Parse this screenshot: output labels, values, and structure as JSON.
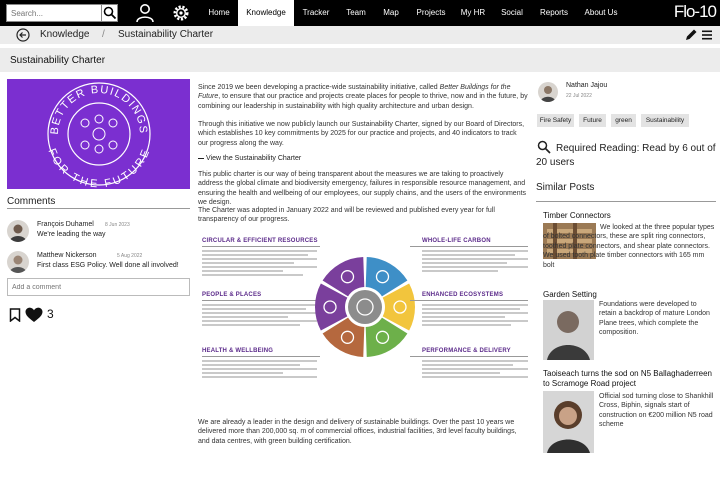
{
  "nav": {
    "search_placeholder": "Search...",
    "items": [
      "Home",
      "Knowledge",
      "Tracker",
      "Team",
      "Map",
      "Projects",
      "My HR",
      "Social",
      "Reports",
      "About Us"
    ],
    "active": "Knowledge",
    "brand": "Flo-10"
  },
  "breadcrumb": {
    "section": "Knowledge",
    "page": "Sustainability Charter"
  },
  "page_title": "Sustainability Charter",
  "hero": {
    "ring_text_top": "BETTER BUILDINGS",
    "ring_text_bottom": "FOR THE FUTURE"
  },
  "comments": {
    "heading": "Comments",
    "items": [
      {
        "name": "François Duhamel",
        "date": "8 Jun 2023",
        "text": "We're leading the way"
      },
      {
        "name": "Matthew Nickerson",
        "date": "5 Aug 2022",
        "text": "First class ESG Policy. Well done all involved!"
      }
    ],
    "input_placeholder": "Add a comment",
    "like_count": "3"
  },
  "article": {
    "p1_a": "Since 2019 we been developing a practice-wide sustainability initiative, called ",
    "p1_em": "Better Buildings for the Future",
    "p1_b": ", to ensure that our practice and projects create places for people to thrive, now and in the future, by combining our leadership in sustainability with high quality architecture and urban design.",
    "p2": "Through this initiative we now publicly launch our Sustainability Charter, signed by our Board of Directors, which establishes 10 key commitments by 2025 for our practice and projects, and 40 indicators to track our progress along the way.",
    "view_link": "View the Sustainability Charter",
    "p3": "This public charter is our way of being transparent about the measures we are taking to proactively address the global climate and biodiversity emergency, failures in responsible resource management, and ensuring the health and wellbeing of our employees, our supply chains, and the users of the environments we design.",
    "p4": "The Charter was adopted in January 2022 and will be reviewed and published every year for full transparency of our progress.",
    "p5": "We are already a leader in the design and delivery of sustainable buildings. Over the past 10 years we delivered more than 200,000 sq. m of commercial offices, industrial facilities, 3rd level faculty buildings, and data centres, with green building certification."
  },
  "diagram": {
    "left_heads": [
      "CIRCULAR & EFFICIENT RESOURCES",
      "PEOPLE & PLACES",
      "HEALTH & WELLBEING"
    ],
    "right_heads": [
      "WHOLE-LIFE CARBON",
      "ENHANCED ECOSYSTEMS",
      "PERFORMANCE & DELIVERY"
    ],
    "colors": {
      "blue": "#3e8fc7",
      "yellow": "#f2c53d",
      "green": "#6db04a",
      "brown": "#b5683e",
      "purple": "#7a3f9c",
      "grey": "#8c8c8c"
    }
  },
  "author": {
    "name": "Nathan Jajou",
    "date": "22 Jul 2022"
  },
  "tags": [
    "Fire Safety",
    "Future",
    "green",
    "Sustainability"
  ],
  "required_reading": "Required Reading: Read by 6 out of 20 users",
  "similar": {
    "heading": "Similar Posts",
    "items": [
      {
        "title": "Timber Connectors",
        "text": "We looked at the three popular types of bolted connectors, these are split ring connectors, toothed plate connectors, and shear plate connectors. We used tooth plate timber connectors with 165 mm bolt"
      },
      {
        "title": "Garden Setting",
        "text": "Foundations were developed to retain a backdrop of mature London Plane trees, which complete the composition."
      },
      {
        "title": "Taoiseach turns the sod on N5 Ballaghaderreen to Scramoge Road project",
        "text": "Official sod turning close to Shankhill Cross, Biphin, signals start of construction on €200 million N5 road scheme"
      }
    ]
  },
  "colors": {
    "nav_bg": "#000000",
    "hero_purple": "#7b2fd0",
    "bar_grey": "#ececec"
  }
}
